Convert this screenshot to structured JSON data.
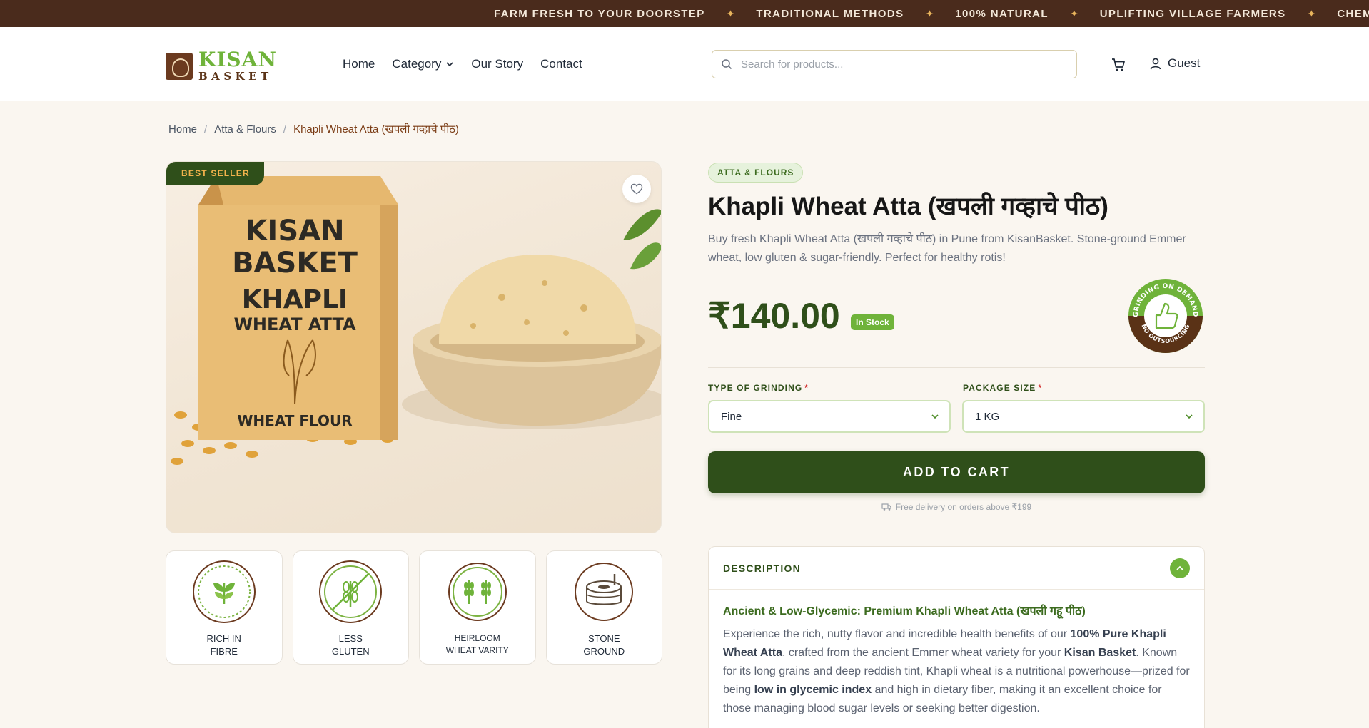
{
  "ticker": [
    "FARM FRESH TO YOUR DOORSTEP",
    "TRADITIONAL METHODS",
    "100% NATURAL",
    "UPLIFTING VILLAGE FARMERS",
    "CHEMIC"
  ],
  "logo": {
    "line1": "KISAN",
    "line2": "BASKET"
  },
  "nav": {
    "home": "Home",
    "category": "Category",
    "story": "Our Story",
    "contact": "Contact"
  },
  "search": {
    "placeholder": "Search for products..."
  },
  "account": {
    "label": "Guest"
  },
  "breadcrumb": {
    "home": "Home",
    "category": "Atta & Flours",
    "current": "Khapli Wheat Atta (खपली गव्हाचे पीठ)"
  },
  "product": {
    "badge": "BEST SELLER",
    "category": "ATTA & FLOURS",
    "title": "Khapli Wheat Atta (खपली गव्हाचे पीठ)",
    "description": "Buy fresh Khapli Wheat Atta (खपली गव्हाचे पीठ) in Pune from KisanBasket. Stone-ground Emmer wheat, low gluten & sugar-friendly. Perfect for healthy rotis!",
    "price": "₹140.00",
    "stock": "In Stock",
    "bag_text": {
      "brand1": "KISAN",
      "brand2": "BASKET",
      "name1": "KHAPLI",
      "name2": "WHEAT ATTA",
      "bottom": "WHEAT FLOUR"
    },
    "seal": {
      "top": "GRINDING ON DEMAND",
      "bottom": "NO OUTSOURCING"
    }
  },
  "features": [
    {
      "line1": "RICH IN",
      "line2": "FIBRE",
      "icon": "sprout-icon"
    },
    {
      "line1": "LESS",
      "line2": "GLUTEN",
      "icon": "no-gluten-icon"
    },
    {
      "line1": "HEIRLOOM",
      "line2": "WHEAT VARITY",
      "icon": "wheat-icon"
    },
    {
      "line1": "STONE",
      "line2": "GROUND",
      "icon": "stone-mill-icon"
    }
  ],
  "options": {
    "grinding": {
      "label": "TYPE OF GRINDING",
      "value": "Fine"
    },
    "size": {
      "label": "PACKAGE SIZE",
      "value": "1 KG"
    },
    "required": "*"
  },
  "cta": {
    "add_to_cart": "ADD TO CART",
    "free_delivery": "Free delivery on orders above ₹199"
  },
  "description_panel": {
    "heading": "DESCRIPTION",
    "subheading": "Ancient & Low-Glycemic: Premium Khapli Wheat Atta (खपली गहू पीठ)",
    "p1": "Experience the rich, nutty flavor and incredible health benefits of our ",
    "b1": "100% Pure Khapli Wheat Atta",
    "p2": ", crafted from the ancient Emmer wheat variety for your ",
    "b2": "Kisan Basket",
    "p3": ". Known for its long grains and deep reddish tint, Khapli wheat is a nutritional powerhouse—prized for being ",
    "b3": "low in glycemic index",
    "p4": " and high in dietary fiber, making it an excellent choice for those managing blood sugar levels or seeking better digestion."
  },
  "colors": {
    "brand_green": "#2f4f1a",
    "accent_green": "#6fb33a",
    "ticker_bg": "#4a2b1c",
    "brown": "#6b3a1f"
  }
}
